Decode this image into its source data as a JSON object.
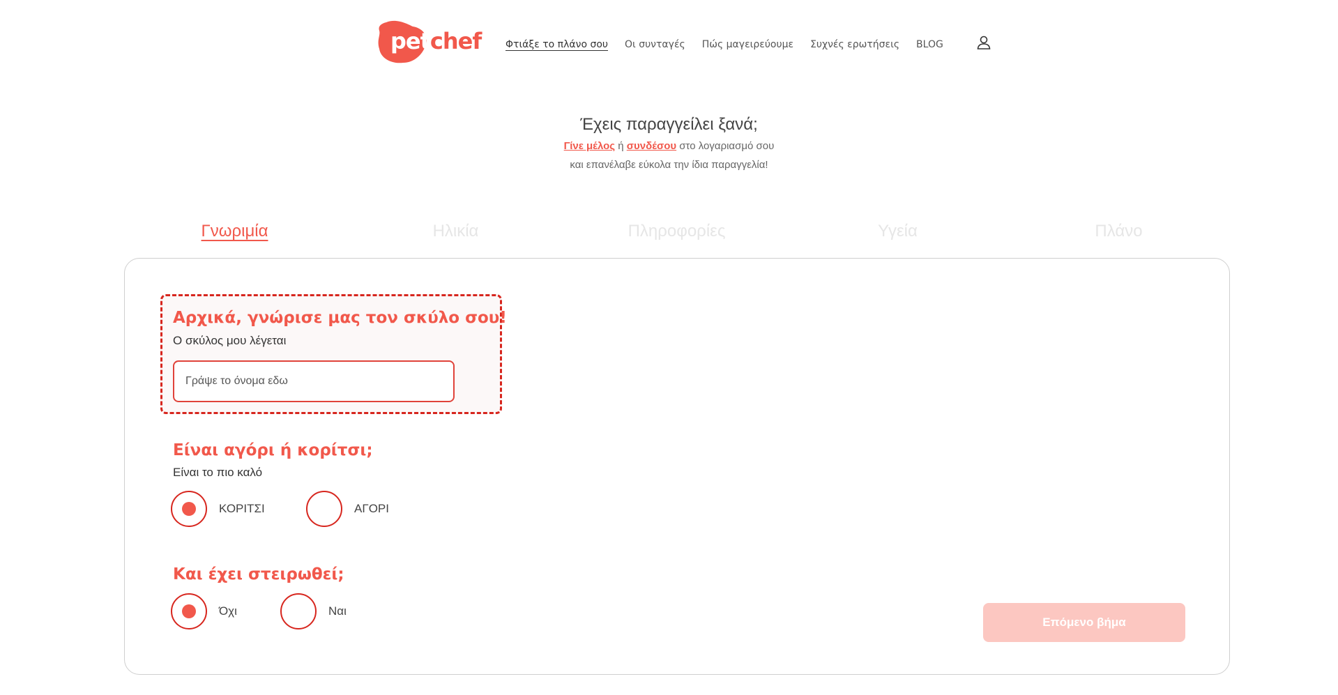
{
  "brand": {
    "logo_pet": "pet",
    "logo_chef": "chef",
    "accent": "#f1584b",
    "accent_dark": "#d7261e",
    "button_disabled": "#fcc7c1"
  },
  "nav": {
    "items": [
      {
        "label": "Φτιάξε το πλάνο σου",
        "active": true
      },
      {
        "label": "Οι συνταγές",
        "active": false
      },
      {
        "label": "Πώς μαγειρεύουμε",
        "active": false
      },
      {
        "label": "Συχνές ερωτήσεις",
        "active": false
      },
      {
        "label": "BLOG",
        "active": false
      }
    ],
    "user_icon": "user-icon"
  },
  "returning": {
    "question": "Έχεις παραγγείλει ξανά;",
    "join_link": "Γίνε μέλος",
    "or_text": "ή",
    "login_link": "συνδέσου",
    "account_text": "στο λογαριασμό σου",
    "line2": "και επανέλαβε εύκολα την ίδια παραγγελία!"
  },
  "steps": [
    {
      "label": "Γνωριμία",
      "active": true
    },
    {
      "label": "Ηλικία",
      "active": false
    },
    {
      "label": "Πληροφορίες",
      "active": false
    },
    {
      "label": "Υγεία",
      "active": false
    },
    {
      "label": "Πλάνο",
      "active": false
    }
  ],
  "form": {
    "intro_title": "Αρχικά, γνώρισε μας τον σκύλο σου!",
    "name_label": "Ο σκύλος μου λέγεται",
    "name_placeholder": "Γράψε το όνομα εδω",
    "name_value": "",
    "gender_title": "Είναι αγόρι ή κορίτσι;",
    "gender_sub": "Είναι το πιο καλό",
    "gender_options": [
      {
        "label": "ΚΟΡΙΤΣΙ",
        "selected": true
      },
      {
        "label": "ΑΓΟΡΙ",
        "selected": false
      }
    ],
    "neuter_title": "Και έχει στειρωθεί;",
    "neuter_options": [
      {
        "label": "Όχι",
        "selected": true
      },
      {
        "label": "Ναι",
        "selected": false
      }
    ],
    "next_label": "Επόμενο βήμα"
  }
}
